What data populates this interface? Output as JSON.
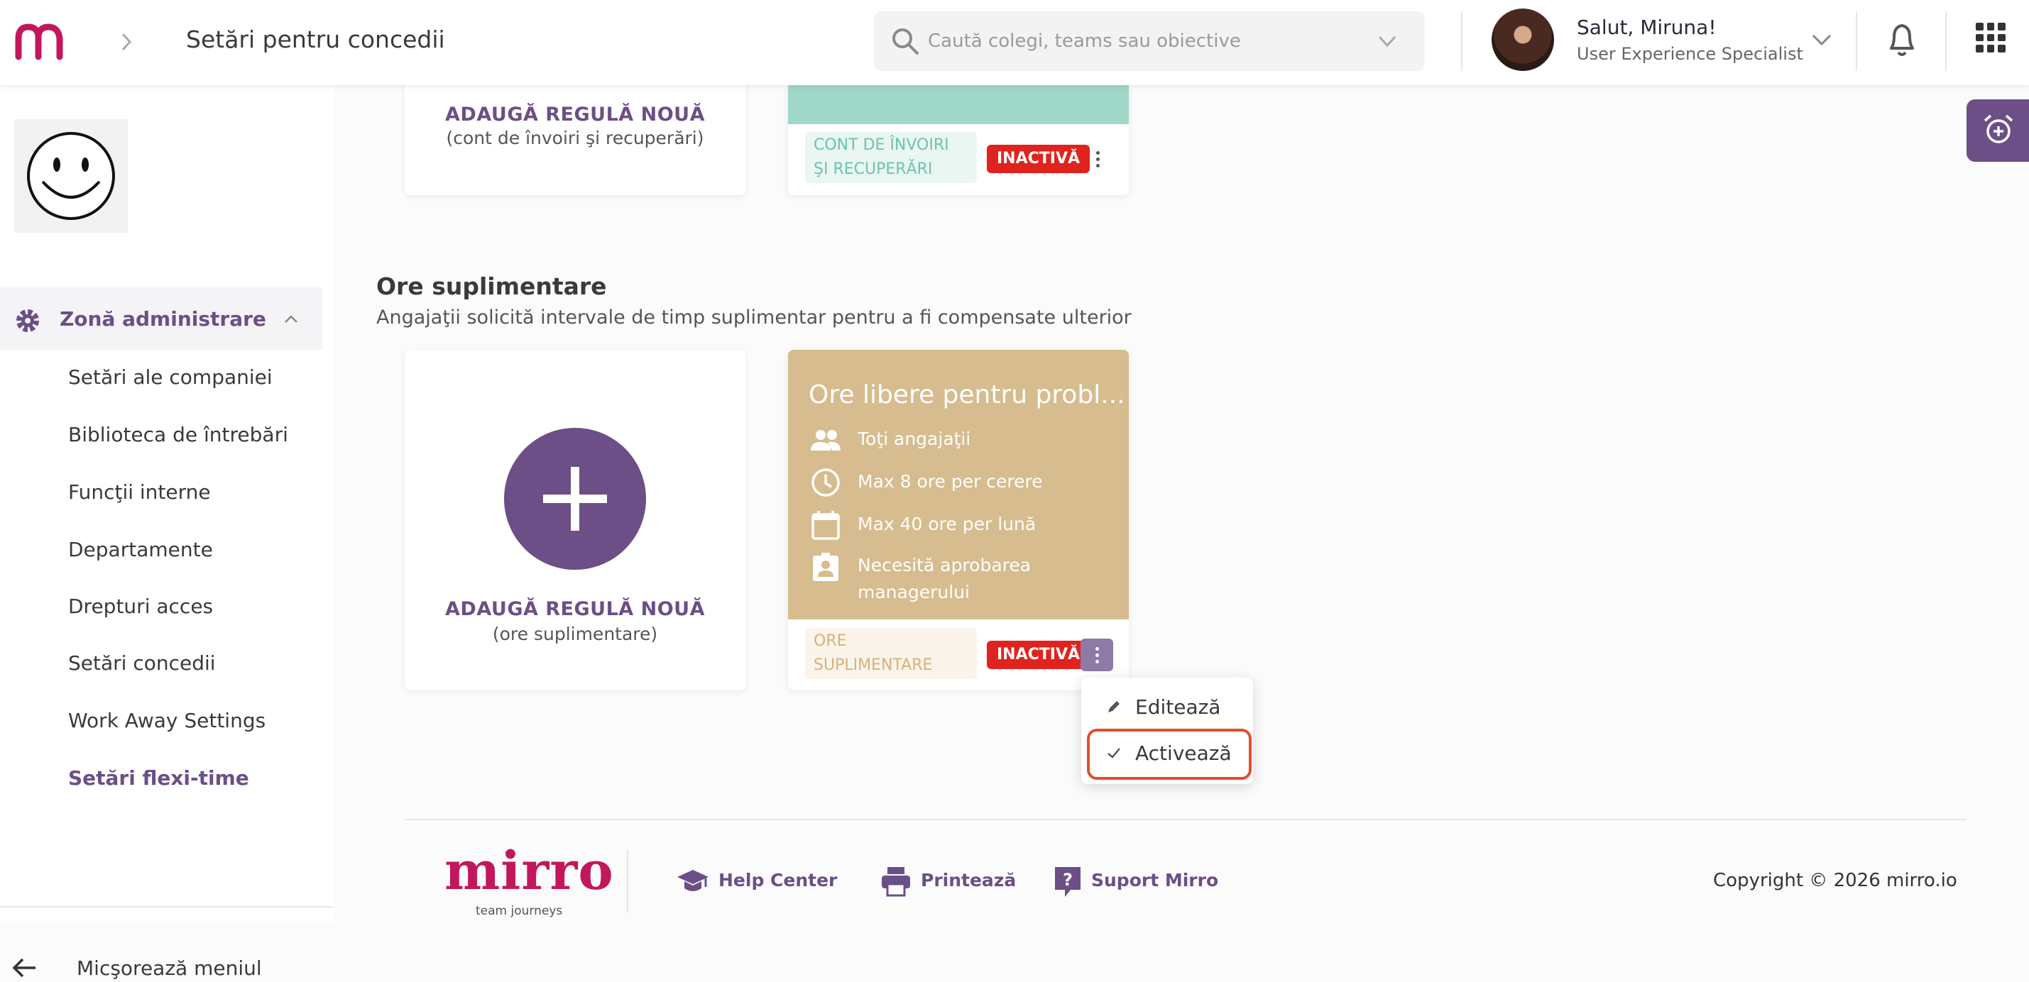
{
  "header": {
    "page_title": "Setări pentru concedii",
    "search_placeholder": "Caută colegi, teams sau obiective",
    "greeting": "Salut, Miruna!",
    "role": "User Experience Specialist"
  },
  "sidebar": {
    "section": "Zonă administrare",
    "items": [
      {
        "label": "Setări ale companiei"
      },
      {
        "label": "Biblioteca de întrebări"
      },
      {
        "label": "Funcţii interne"
      },
      {
        "label": "Departamente"
      },
      {
        "label": "Drepturi acces"
      },
      {
        "label": "Setări concedii"
      },
      {
        "label": "Work Away Settings"
      },
      {
        "label": "Setări flexi-time"
      }
    ],
    "active_item": "Setări flexi-time",
    "collapse_label": "Micşorează meniul"
  },
  "top_section": {
    "add_title": "ADAUGĂ REGULĂ NOUĂ",
    "add_sub": "(cont de învoiri şi recuperări)",
    "tag": "CONT DE ÎNVOIRI ŞI RECUPERĂRI",
    "tag_lines": [
      "CONT DE ÎNVOIRI",
      "ŞI RECUPERĂRI"
    ],
    "status": "INACTIVĂ"
  },
  "overtime": {
    "title": "Ore suplimentare",
    "description": "Angajaţii solicită intervale de timp suplimentar pentru a fi compensate ulterior",
    "add_title": "ADAUGĂ REGULĂ NOUĂ",
    "add_sub": "(ore suplimentare)",
    "rule": {
      "title": "Ore libere pentru probl...",
      "lines": [
        {
          "icon": "people-icon",
          "text": "Toţi angajaţii"
        },
        {
          "icon": "clock-icon",
          "text": "Max 8 ore per cerere"
        },
        {
          "icon": "calendar-icon",
          "text": "Max 40 ore per lună"
        },
        {
          "icon": "badge-icon",
          "text": "Necesită aprobarea managerului"
        }
      ],
      "approval_lines": [
        "Necesită aprobarea",
        "managerului"
      ],
      "tag": "ORE SUPLIMENTARE",
      "tag_lines": [
        "ORE",
        "SUPLIMENTARE"
      ],
      "status": "INACTIVĂ"
    }
  },
  "menu": {
    "edit": "Editează",
    "activate": "Activează"
  },
  "footer": {
    "brand": "mirro",
    "tagline": "team journeys",
    "help": "Help Center",
    "print": "Printează",
    "support": "Suport Mirro",
    "copyright": "Copyright © 2026 mirro.io"
  },
  "colors": {
    "accent": "#6b4f86",
    "brand": "#c2185b",
    "inactive": "#e0231f",
    "rule_card": "#d6bc8e",
    "teal_card": "#9fd8c8"
  }
}
